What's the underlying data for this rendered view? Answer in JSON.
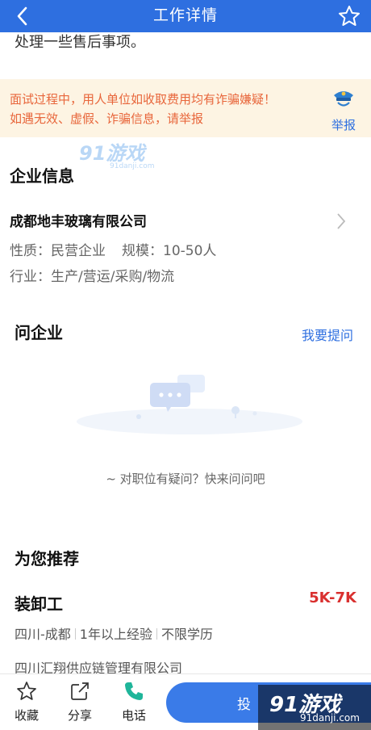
{
  "header": {
    "title": "工作详情",
    "back_icon": "chevron-left-icon",
    "favorite_icon": "star-outline-icon",
    "bg_color": "#2e6fe0"
  },
  "description_tail": "处理一些售后事项。",
  "warning": {
    "line1": "面试过程中，用人单位如收取费用均有诈骗嫌疑！",
    "line2": "如遇无效、虚假、诈骗信息，请举报",
    "report_label": "举报",
    "report_icon": "police-badge-icon"
  },
  "watermark_top": {
    "logo": "91游戏",
    "url": "91danji.com"
  },
  "company_section": {
    "title": "企业信息",
    "name": "成都地丰玻璃有限公司",
    "nature": "性质：民营企业",
    "scale": "规模：10-50人",
    "industry": "行业：生产/营运/采购/物流"
  },
  "qa_section": {
    "title": "问企业",
    "ask_link": "我要提问",
    "empty_tip": "~ 对职位有疑问？快来问问吧"
  },
  "recommend_section": {
    "title": "为您推荐",
    "job": {
      "title": "装卸工",
      "salary": "5K-7K",
      "location": "四川-成都",
      "experience": "1年以上经验",
      "education": "不限学历",
      "company": "四川汇翔供应链管理有限公司"
    }
  },
  "bottom_bar": {
    "favorite": "收藏",
    "share": "分享",
    "phone": "电话",
    "apply": "投"
  },
  "watermark_corner": {
    "logo": "91游戏",
    "url": "91danji.com"
  },
  "colors": {
    "accent": "#2e6fe0",
    "warning_bg": "#fdf4e3",
    "warning_text": "#e8663b",
    "salary": "#d9302f",
    "phone_icon": "#1fb59a"
  }
}
